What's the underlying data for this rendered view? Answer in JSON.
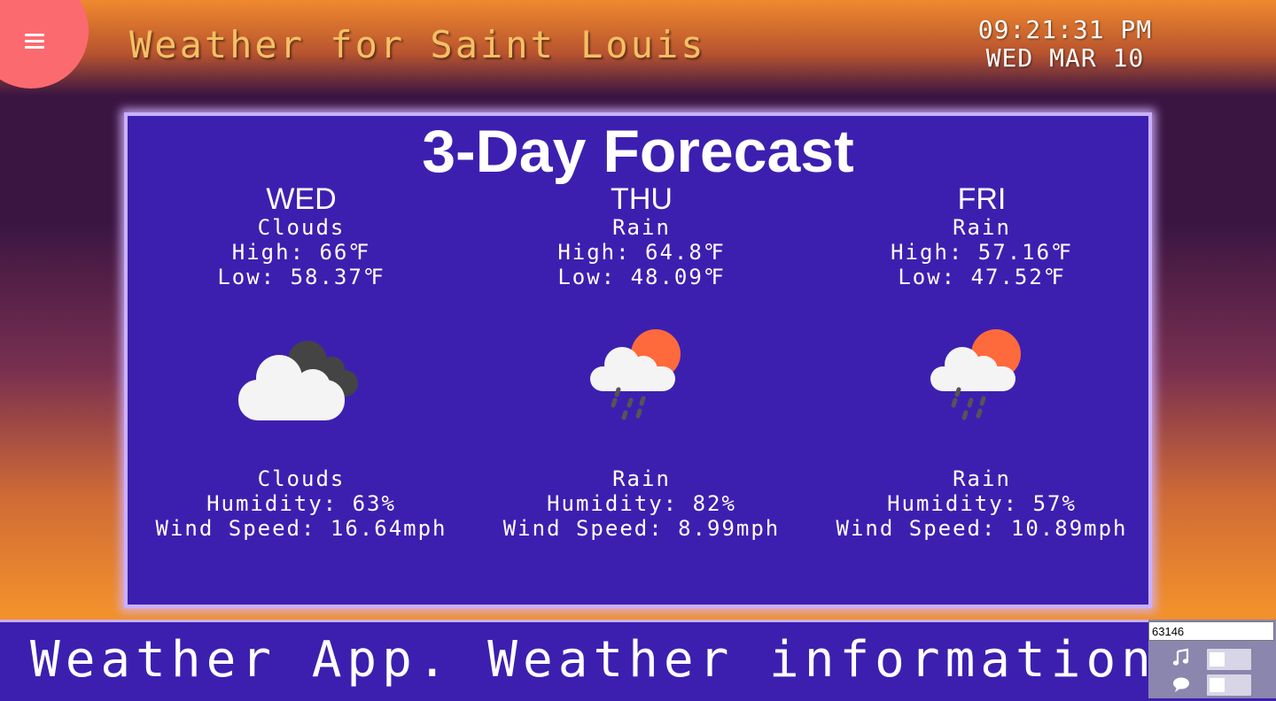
{
  "header": {
    "menu_icon": "hamburger-menu-icon",
    "title": "Weather for Saint Louis",
    "time": "09:21:31 PM",
    "date": "WED MAR 10"
  },
  "forecast": {
    "title": "3-Day Forecast",
    "days": [
      {
        "day": "WED",
        "condition": "Clouds",
        "high": "High: 66℉",
        "low": "Low: 58.37℉",
        "icon": "cloudy-icon",
        "condition2": "Clouds",
        "humidity": "Humidity: 63%",
        "wind": "Wind Speed: 16.64mph"
      },
      {
        "day": "THU",
        "condition": "Rain",
        "high": "High: 64.8℉",
        "low": "Low: 48.09℉",
        "icon": "rain-sun-icon",
        "condition2": "Rain",
        "humidity": "Humidity: 82%",
        "wind": "Wind Speed: 8.99mph"
      },
      {
        "day": "FRI",
        "condition": "Rain",
        "high": "High: 57.16℉",
        "low": "Low: 47.52℉",
        "icon": "rain-sun-icon",
        "condition2": "Rain",
        "humidity": "Humidity: 57%",
        "wind": "Wind Speed: 10.89mph"
      }
    ]
  },
  "ticker": {
    "text": "Weather App. Weather information is o"
  },
  "controls": {
    "zip_value": "63146",
    "music_icon": "music-note-icon",
    "chat_icon": "speech-bubble-icon"
  },
  "colors": {
    "panel": "#3d1fb0",
    "panel_border": "#c9b0ff",
    "title_text": "#f4c064",
    "menu_blob": "#fb6a6f",
    "sun": "#ff6a3d"
  }
}
